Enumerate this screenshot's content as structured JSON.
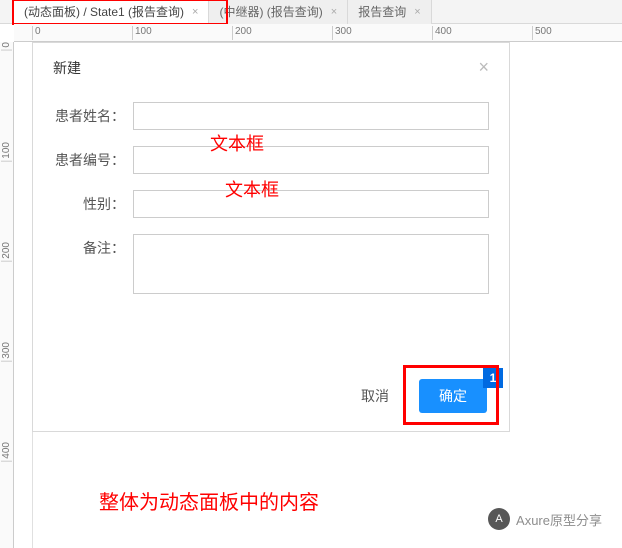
{
  "tabs": [
    {
      "label": "(动态面板) / State1 (报告查询)",
      "active": true
    },
    {
      "label": "(中继器) (报告查询)",
      "active": false
    },
    {
      "label": "报告查询",
      "active": false
    }
  ],
  "ruler_h": [
    "0",
    "100",
    "200",
    "300",
    "400",
    "500"
  ],
  "ruler_v": [
    "0",
    "100",
    "200",
    "300",
    "400"
  ],
  "dialog": {
    "title": "新建",
    "close_glyph": "×",
    "fields": {
      "name_label": "患者姓名：",
      "id_label": "患者编号：",
      "gender_label": "性别：",
      "remark_label": "备注："
    },
    "buttons": {
      "cancel": "取消",
      "confirm": "确定",
      "badge": "1"
    }
  },
  "annotations": {
    "input1": "文本框",
    "input2": "文本框",
    "bottom": "整体为动态面板中的内容"
  },
  "watermark": {
    "logo": "A",
    "text": "Axure原型分享"
  }
}
